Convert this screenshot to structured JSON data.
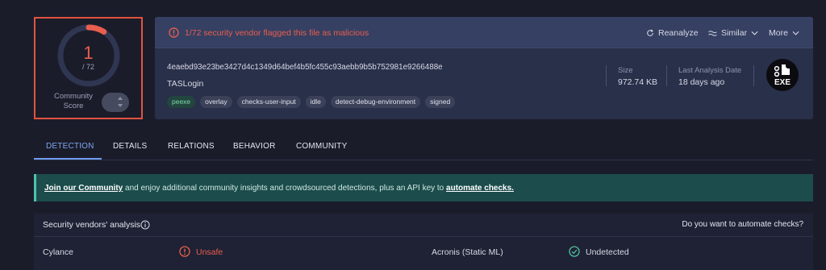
{
  "score": {
    "detections": "1",
    "total": "/ 72",
    "detection_fraction": 0.0139,
    "community_label": "Community Score",
    "color": "#ea5e4e"
  },
  "header": {
    "alert_text": "1/72 security vendor flagged this file as malicious",
    "actions": {
      "reanalyze": "Reanalyze",
      "similar": "Similar",
      "more": "More"
    },
    "hash": "4eaebd93e23be3427d4c1349d64bef4b5fc455c93aebb9b5b752981e9266488e",
    "filename": "TASLogin",
    "tags": [
      "peexe",
      "overlay",
      "checks-user-input",
      "idle",
      "detect-debug-environment",
      "signed"
    ],
    "size_label": "Size",
    "size_value": "972.74 KB",
    "last_analysis_label": "Last Analysis Date",
    "last_analysis_value": "18 days ago",
    "file_type_badge": "EXE"
  },
  "tabs": [
    "DETECTION",
    "DETAILS",
    "RELATIONS",
    "BEHAVIOR",
    "COMMUNITY"
  ],
  "banner": {
    "link1": "Join our Community",
    "middle": " and enjoy additional community insights and crowdsourced detections, plus an API key to ",
    "link2": "automate checks."
  },
  "vendors": {
    "title": "Security vendors' analysis",
    "automate_prompt": "Do you want to automate checks?",
    "rows": [
      {
        "vendor1": "Cylance",
        "result1": "Unsafe",
        "vendor2": "Acronis (Static ML)",
        "result2": "Undetected"
      }
    ]
  },
  "colors": {
    "background": "#1b1c2a",
    "card": "#29304a",
    "alert_red": "#ea5e4e",
    "active_tab": "#7ea6f0",
    "banner": "#1c4c4c",
    "ok_green": "#4ec2a0"
  },
  "icons": [
    "alert-circle-icon",
    "reanalyze-icon",
    "similar-icon",
    "chevron-down-icon",
    "info-icon",
    "unsafe-icon",
    "check-circle-icon",
    "exe-file-icon"
  ]
}
